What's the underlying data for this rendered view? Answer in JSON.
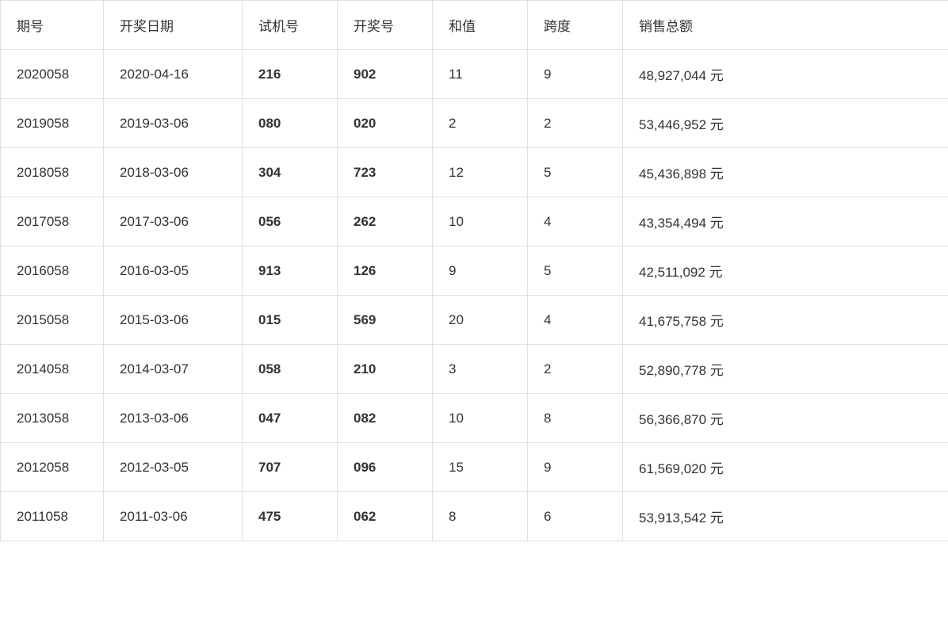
{
  "table": {
    "headers": [
      "期号",
      "开奖日期",
      "试机号",
      "开奖号",
      "和值",
      "跨度",
      "销售总额"
    ],
    "rows": [
      {
        "qihao": "2020058",
        "date": "2020-04-16",
        "shiji": "216",
        "kaijia": "902",
        "hezhi": "11",
        "kuadu": "9",
        "xiaoshou": "48,927,044 元"
      },
      {
        "qihao": "2019058",
        "date": "2019-03-06",
        "shiji": "080",
        "kaijia": "020",
        "hezhi": "2",
        "kuadu": "2",
        "xiaoshou": "53,446,952 元"
      },
      {
        "qihao": "2018058",
        "date": "2018-03-06",
        "shiji": "304",
        "kaijia": "723",
        "hezhi": "12",
        "kuadu": "5",
        "xiaoshou": "45,436,898 元"
      },
      {
        "qihao": "2017058",
        "date": "2017-03-06",
        "shiji": "056",
        "kaijia": "262",
        "hezhi": "10",
        "kuadu": "4",
        "xiaoshou": "43,354,494 元"
      },
      {
        "qihao": "2016058",
        "date": "2016-03-05",
        "shiji": "913",
        "kaijia": "126",
        "hezhi": "9",
        "kuadu": "5",
        "xiaoshou": "42,511,092 元"
      },
      {
        "qihao": "2015058",
        "date": "2015-03-06",
        "shiji": "015",
        "kaijia": "569",
        "hezhi": "20",
        "kuadu": "4",
        "xiaoshou": "41,675,758 元"
      },
      {
        "qihao": "2014058",
        "date": "2014-03-07",
        "shiji": "058",
        "kaijia": "210",
        "hezhi": "3",
        "kuadu": "2",
        "xiaoshou": "52,890,778 元"
      },
      {
        "qihao": "2013058",
        "date": "2013-03-06",
        "shiji": "047",
        "kaijia": "082",
        "hezhi": "10",
        "kuadu": "8",
        "xiaoshou": "56,366,870 元"
      },
      {
        "qihao": "2012058",
        "date": "2012-03-05",
        "shiji": "707",
        "kaijia": "096",
        "hezhi": "15",
        "kuadu": "9",
        "xiaoshou": "61,569,020 元"
      },
      {
        "qihao": "2011058",
        "date": "2011-03-06",
        "shiji": "475",
        "kaijia": "062",
        "hezhi": "8",
        "kuadu": "6",
        "xiaoshou": "53,913,542 元"
      }
    ]
  }
}
